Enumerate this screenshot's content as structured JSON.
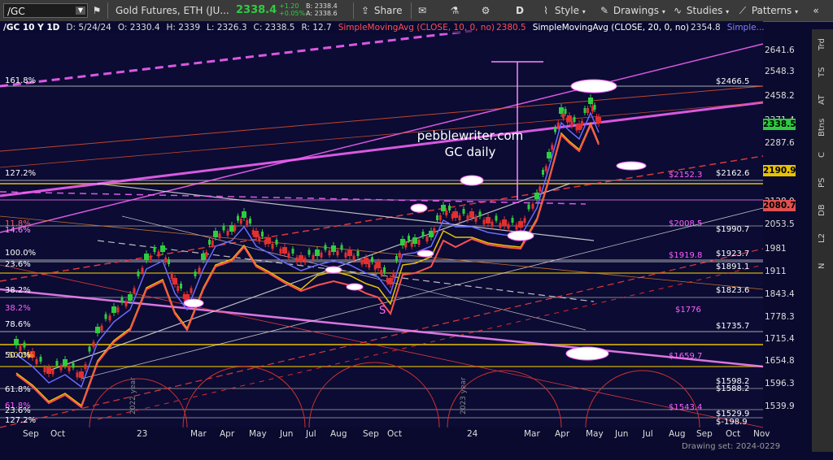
{
  "toolbar": {
    "symbol": "/GC",
    "symbol_name": "Gold Futures, ETH (JU...",
    "last_price": "2338.4",
    "change_abs": "+1.20",
    "change_pct": "+0.05%",
    "bid": "B: 2338.4",
    "ask": "A: 2338.6",
    "share_label": "Share",
    "period_label": "D",
    "style_label": "Style",
    "drawings_label": "Drawings",
    "studies_label": "Studies",
    "patterns_label": "Patterns"
  },
  "info_bar": {
    "title": "/GC 10 Y 1D",
    "date": "D: 5/24/24",
    "open": "O: 2330.4",
    "high": "H: 2339",
    "low": "L: 2326.3",
    "close": "C: 2338.5",
    "range": "R: 12.7",
    "sma10": "SimpleMovingAvg (CLOSE, 10, 0, no)",
    "sma10_val": "2380.5",
    "sma20": "SimpleMovingAvg (CLOSE, 20, 0, no)",
    "sma20_val": "2354.8",
    "more": "Simple..."
  },
  "right_tabs": [
    "Trd",
    "TS",
    "AT",
    "Btns",
    "C",
    "PS",
    "DB",
    "L2",
    "N"
  ],
  "price_axis": [
    "2641.6",
    "2548.3",
    "2458.2",
    "2371.4",
    "2287.6",
    "2128.9",
    "2053.5",
    "1981",
    "1911",
    "1843.4",
    "1778.3",
    "1715.4",
    "1654.8",
    "1596.3",
    "1539.9"
  ],
  "price_tags": [
    {
      "value": "2338.5",
      "color": "#2ecc40"
    },
    {
      "value": "2190.9",
      "color": "#e8c200"
    },
    {
      "value": "2080.7",
      "color": "#e05050"
    }
  ],
  "time_axis": [
    "Sep",
    "Oct",
    "23",
    "Mar",
    "Apr",
    "May",
    "Jun",
    "Jul",
    "Aug",
    "Sep",
    "Oct",
    "24",
    "Mar",
    "Apr",
    "May",
    "Jun",
    "Jul",
    "Aug",
    "Sep",
    "Oct",
    "Nov"
  ],
  "drawing_date": "Drawing set: 2024-0229",
  "watermark": {
    "line1": "pebblewriter.com",
    "line2": "GC daily"
  },
  "fib_left": [
    {
      "label": "161.8%",
      "color": "#ffffff"
    },
    {
      "label": "127.2%",
      "color": "#ffffff"
    },
    {
      "label": "11.8%",
      "color": "#ff6060"
    },
    {
      "label": "14.6%",
      "color": "#ff90ff"
    },
    {
      "label": "100.0%",
      "color": "#ffffff"
    },
    {
      "label": "23.6%",
      "color": "#ffffff"
    },
    {
      "label": "38.2%",
      "color": "#ffffff"
    },
    {
      "label": "38.2%",
      "color": "#ff60ff"
    },
    {
      "label": "78.6%",
      "color": "#ffffff"
    },
    {
      "label": "50.0%",
      "color": "#e8c200"
    },
    {
      "label": "50.0%",
      "color": "#ffffff"
    },
    {
      "label": "61.8%",
      "color": "#ffffff"
    },
    {
      "label": "61.8%",
      "color": "#ff60ff"
    },
    {
      "label": "23.6%",
      "color": "#ffffff"
    },
    {
      "label": "127.2%",
      "color": "#ffffff"
    }
  ],
  "fib_right": [
    {
      "label": "$2466.5",
      "color": "#ffffff"
    },
    {
      "label": "$2162.6",
      "color": "#ffffff"
    },
    {
      "label": "$2152.3",
      "color": "#ff60ff"
    },
    {
      "label": "$2008.5",
      "color": "#ff60ff"
    },
    {
      "label": "$1990.7",
      "color": "#ffffff"
    },
    {
      "label": "$1923.7",
      "color": "#ffffff"
    },
    {
      "label": "$1919.8",
      "color": "#ff60ff"
    },
    {
      "label": "$1891.1",
      "color": "#ffffff"
    },
    {
      "label": "$1823.6",
      "color": "#ffffff"
    },
    {
      "label": "$1776",
      "color": "#ff60ff"
    },
    {
      "label": "$1735.7",
      "color": "#ffffff"
    },
    {
      "label": "$1659.7",
      "color": "#ff60ff"
    },
    {
      "label": "$1598.2",
      "color": "#ffffff"
    },
    {
      "label": "$1588.2",
      "color": "#ffffff"
    },
    {
      "label": "$1543.4",
      "color": "#ff60ff"
    },
    {
      "label": "$1529.9",
      "color": "#ffffff"
    },
    {
      "label": "$-198.9",
      "color": "#ffffff"
    }
  ],
  "year_labels": [
    "2022 year",
    "2023 year"
  ],
  "s_label": "S"
}
